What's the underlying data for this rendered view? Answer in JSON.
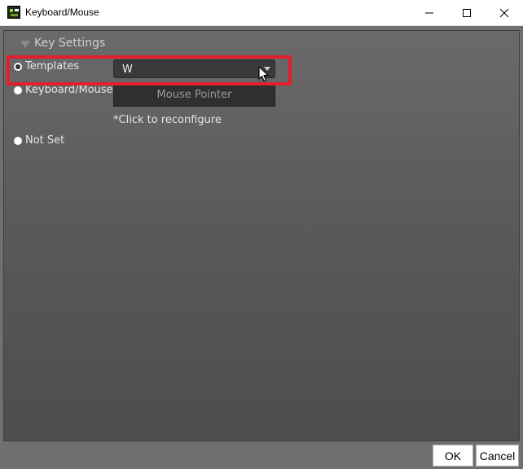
{
  "window": {
    "title": "Keyboard/Mouse"
  },
  "group": {
    "title": "Key Settings"
  },
  "options": {
    "templates": "Templates",
    "keyboard_mouse": "Keyboard/Mouse",
    "not_set": "Not Set"
  },
  "dropdown": {
    "value": "W"
  },
  "mouse_pointer_button": "Mouse Pointer",
  "note": "*Click to reconfigure",
  "buttons": {
    "ok": "OK",
    "cancel": "Cancel"
  },
  "colors": {
    "highlight": "#e0202a",
    "panel": "#5a5a5a"
  }
}
